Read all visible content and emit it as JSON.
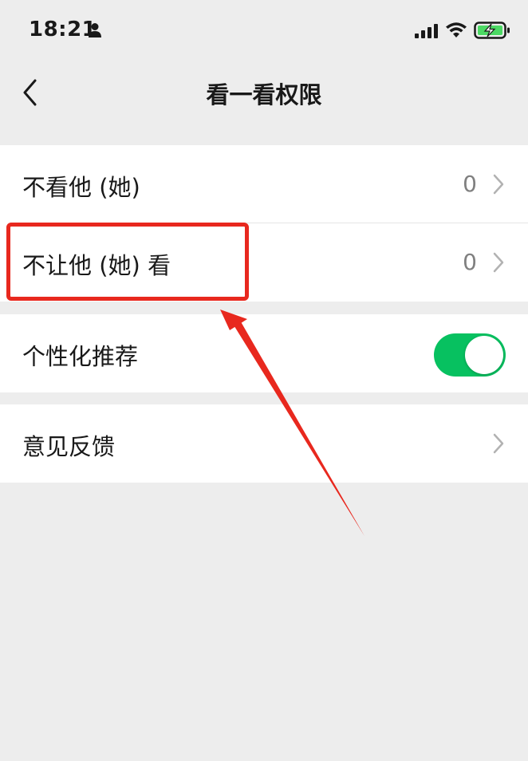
{
  "status_bar": {
    "time": "18:21",
    "icons": [
      "person-icon",
      "signal-icon",
      "wifi-icon",
      "battery-charging-icon"
    ]
  },
  "nav": {
    "title": "看一看权限",
    "back_icon": "chevron-left-icon"
  },
  "groups": [
    {
      "items": [
        {
          "label": "不看他 (她)",
          "value": "0",
          "icon": "chevron-right-icon"
        },
        {
          "label": "不让他 (她) 看",
          "value": "0",
          "icon": "chevron-right-icon"
        }
      ]
    },
    {
      "items": [
        {
          "label": "个性化推荐",
          "toggle_on": true
        }
      ]
    },
    {
      "items": [
        {
          "label": "意见反馈",
          "icon": "chevron-right-icon"
        }
      ]
    }
  ],
  "colors": {
    "background": "#ededed",
    "cell_background": "#ffffff",
    "toggle_on": "#07c160",
    "annotation_red": "#e8281e",
    "secondary_text": "#808080"
  }
}
